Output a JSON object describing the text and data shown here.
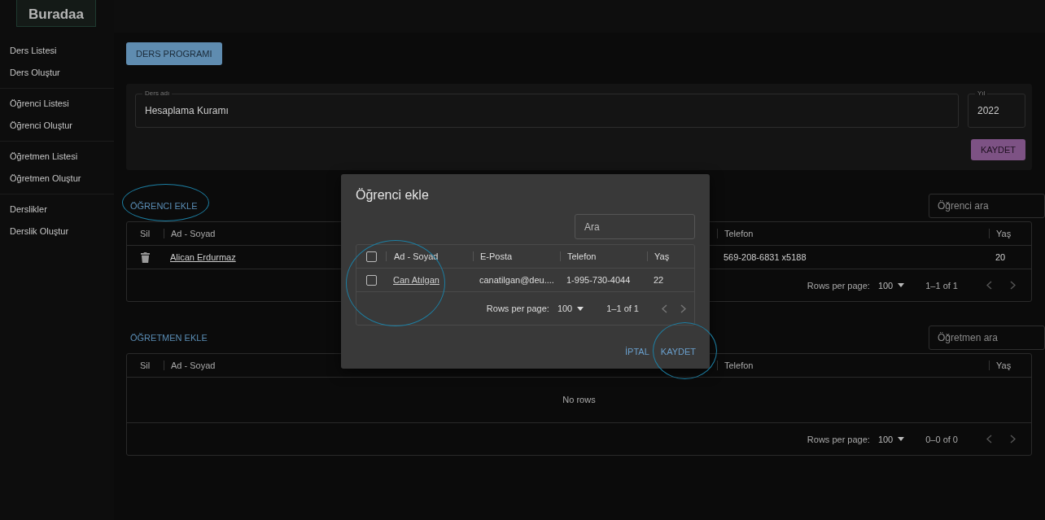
{
  "sidebar": {
    "logo": "Buradaa",
    "groups": [
      [
        {
          "label": "Ders Listesi",
          "selected": false
        },
        {
          "label": "Ders Oluştur",
          "selected": false
        }
      ],
      [
        {
          "label": "Öğrenci Listesi",
          "selected": false
        },
        {
          "label": "Öğrenci Oluştur",
          "selected": false
        }
      ],
      [
        {
          "label": "Öğretmen Listesi",
          "selected": false
        },
        {
          "label": "Öğretmen Oluştur",
          "selected": false
        }
      ],
      [
        {
          "label": "Derslikler",
          "selected": false
        },
        {
          "label": "Derslik Oluştur",
          "selected": false
        }
      ]
    ]
  },
  "program_button": "DERS PROGRAMI",
  "course_form": {
    "name_field": {
      "label": "Ders adı",
      "value": "Hesaplama Kuramı"
    },
    "year_field": {
      "label": "Yıl",
      "value": "2022"
    },
    "save_button": "KAYDET"
  },
  "student_section": {
    "add_link": "ÖĞRENCI EKLE",
    "search": {
      "placeholder": "Öğrenci ara"
    },
    "columns": [
      "Sil",
      "Ad - Soyad",
      "Telefon",
      "Yaş"
    ],
    "rows": [
      {
        "name": "Alican Erdurmaz",
        "phone": "569-208-6831 x5188",
        "age": "20"
      }
    ],
    "rows_per_page_label": "Rows per page:",
    "rows_per_page": "100",
    "range": "1–1 of 1"
  },
  "teacher_section": {
    "add_link": "ÖĞRETMEN EKLE",
    "search": {
      "placeholder": "Öğretmen ara"
    },
    "columns": [
      "Sil",
      "Ad - Soyad",
      "Telefon",
      "Yaş"
    ],
    "empty_text": "No rows",
    "rows_per_page_label": "Rows per page:",
    "rows_per_page": "100",
    "range": "0–0 of 0"
  },
  "dialog": {
    "title": "Öğrenci ekle",
    "search": {
      "placeholder": "Ara"
    },
    "select_all_checked": false,
    "columns": [
      "Ad - Soyad",
      "E-Posta",
      "Telefon",
      "Yaş"
    ],
    "rows": [
      {
        "checked": false,
        "name": "Can Atılgan",
        "email": "canatilgan@deu....",
        "phone": "1-995-730-4044",
        "age": "22"
      }
    ],
    "rows_per_page_label": "Rows per page:",
    "rows_per_page": "100",
    "range": "1–1 of 1",
    "buttons": [
      "İPTAL",
      "KAYDET"
    ]
  }
}
